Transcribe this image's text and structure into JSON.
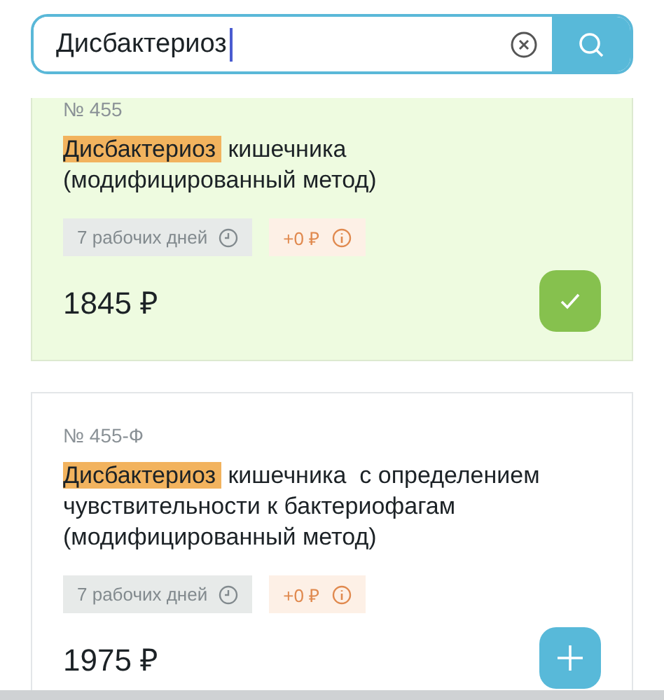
{
  "search": {
    "value": "Дисбактериоз"
  },
  "results": [
    {
      "number": "№ 455",
      "highlight": "Дисбактериоз",
      "title": "кишечника\n(модифицированный метод)",
      "duration": "7 рабочих дней",
      "surcharge": "+0 ₽",
      "price": "1845 ₽",
      "selected": true
    },
    {
      "number": "№ 455-Ф",
      "highlight": "Дисбактериоз",
      "title": "кишечника  с определением\nчувствительности к бактериофагам\n(модифицированный метод)",
      "duration": "7 рабочих дней",
      "surcharge": "+0 ₽",
      "price": "1975 ₽",
      "selected": false
    }
  ]
}
